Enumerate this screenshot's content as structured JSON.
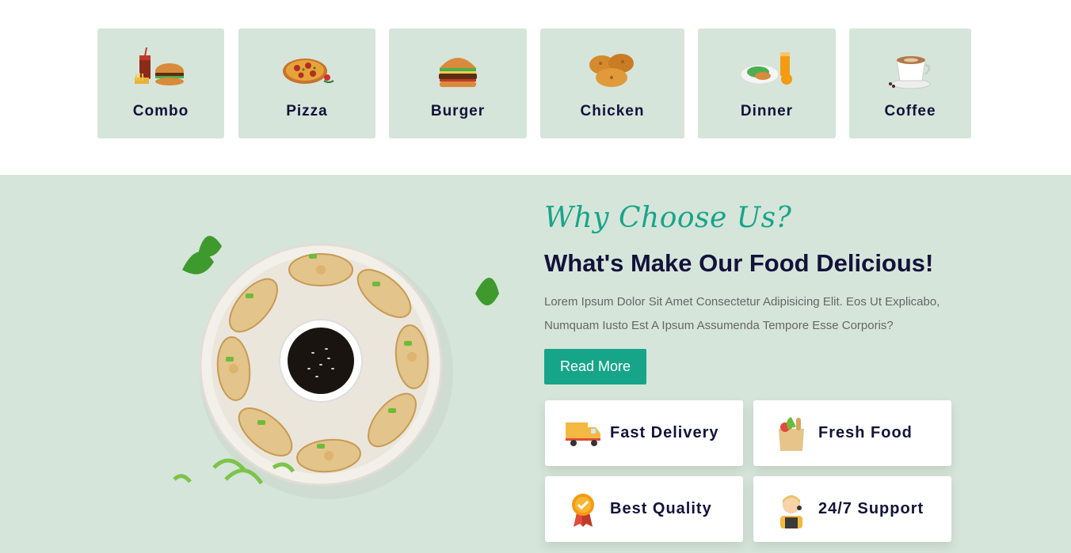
{
  "categories": [
    {
      "label": "Combo",
      "icon": "combo-meal-icon"
    },
    {
      "label": "Pizza",
      "icon": "pizza-icon"
    },
    {
      "label": "Burger",
      "icon": "burger-icon"
    },
    {
      "label": "Chicken",
      "icon": "fried-chicken-icon"
    },
    {
      "label": "Dinner",
      "icon": "dinner-plate-icon"
    },
    {
      "label": "Coffee",
      "icon": "coffee-cup-icon"
    }
  ],
  "why": {
    "subtitle": "Why Choose Us?",
    "title": "What's Make Our Food Delicious!",
    "description": "Lorem Ipsum Dolor Sit Amet Consectetur Adipisicing Elit. Eos Ut Explicabo, Numquam Iusto Est A Ipsum Assumenda Tempore Esse Corporis?",
    "button_label": "Read More",
    "features": [
      {
        "label": "Fast Delivery",
        "icon": "delivery-truck-icon"
      },
      {
        "label": "Fresh Food",
        "icon": "grocery-bag-icon"
      },
      {
        "label": "Best Quality",
        "icon": "quality-badge-icon"
      },
      {
        "label": "24/7 Support",
        "icon": "support-agent-icon"
      }
    ]
  },
  "colors": {
    "accent": "#17a589",
    "section_bg": "#d6e5da",
    "heading": "#12123a"
  }
}
